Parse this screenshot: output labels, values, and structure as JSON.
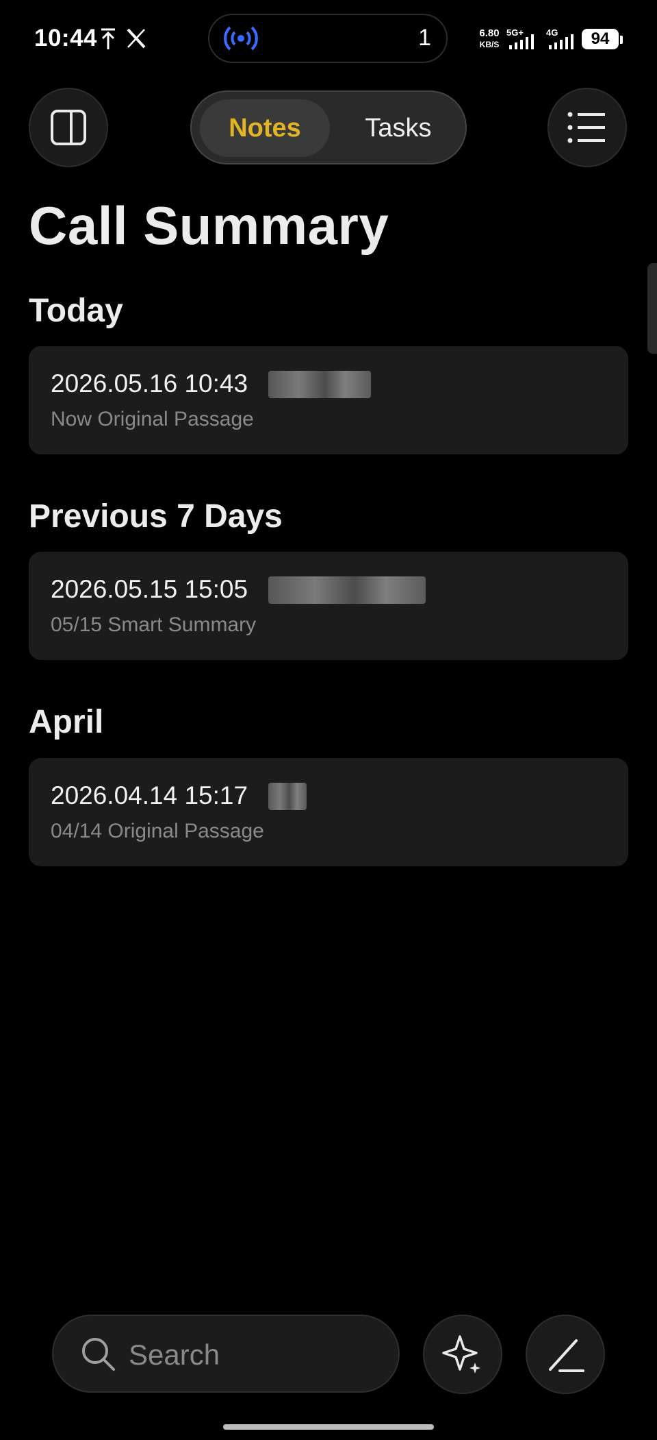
{
  "status_bar": {
    "time": "10:44",
    "island_count": "1",
    "net_speed_value": "6.80",
    "net_speed_unit": "KB/S",
    "signal_1_label": "5G+",
    "signal_2_label": "4G",
    "battery": "94",
    "icons": [
      "upload-arrow-icon",
      "x-app-icon",
      "broadcast-icon",
      "signal-icon",
      "battery-icon"
    ]
  },
  "top_bar": {
    "tabs": [
      {
        "label": "Notes",
        "active": true
      },
      {
        "label": "Tasks",
        "active": false
      }
    ],
    "accent_color": "#e2b524",
    "icons": [
      "sidebar-toggle-icon",
      "list-menu-icon"
    ]
  },
  "page": {
    "title": "Call Summary"
  },
  "sections": [
    {
      "header": "Today",
      "items": [
        {
          "title": "2026.05.16 10:43",
          "subtitle": "Now Original Passage"
        }
      ]
    },
    {
      "header": "Previous 7 Days",
      "items": [
        {
          "title": "2026.05.15 15:05",
          "subtitle": "05/15 Smart Summary"
        }
      ]
    },
    {
      "header": "April",
      "items": [
        {
          "title": "2026.04.14 15:17",
          "subtitle": "04/14 Original Passage"
        }
      ]
    }
  ],
  "bottom_bar": {
    "search_placeholder": "Search",
    "icons": [
      "search-icon",
      "ai-sparkle-icon",
      "compose-pen-icon"
    ]
  }
}
